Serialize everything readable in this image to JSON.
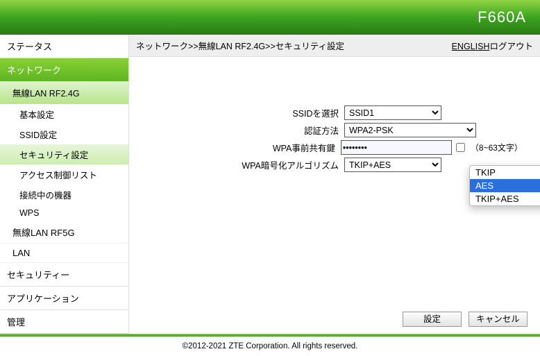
{
  "header": {
    "model": "F660A"
  },
  "sidebar": {
    "status": "ステータス",
    "network": "ネットワーク",
    "wlan24": "無線LAN RF2.4G",
    "basic": "基本設定",
    "ssid": "SSID設定",
    "security": "セキュリティ設定",
    "acl": "アクセス制御リスト",
    "connected": "接続中の機器",
    "wps": "WPS",
    "wlan5": "無線LAN RF5G",
    "lan": "LAN",
    "sec": "セキュリティー",
    "app": "アプリケーション",
    "admin": "管理"
  },
  "breadcrumb": {
    "text": "ネットワーク>>無線LAN RF2.4G>>セキュリティ設定",
    "english": "ENGLISH",
    "logout": "ログアウト"
  },
  "form": {
    "ssid_label": "SSIDを選択",
    "ssid_value": "SSID1",
    "auth_label": "認証方法",
    "auth_value": "WPA2-PSK",
    "psk_label": "WPA事前共有鍵",
    "psk_value": "••••••••",
    "psk_hint": "（8~63文字）",
    "enc_label": "WPA暗号化アルゴリズム",
    "enc_value": "TKIP+AES",
    "enc_options": {
      "tkip": "TKIP",
      "aes": "AES",
      "both": "TKIP+AES"
    }
  },
  "buttons": {
    "apply": "設定",
    "cancel": "キャンセル"
  },
  "footer": "©2012-2021 ZTE Corporation. All rights reserved."
}
